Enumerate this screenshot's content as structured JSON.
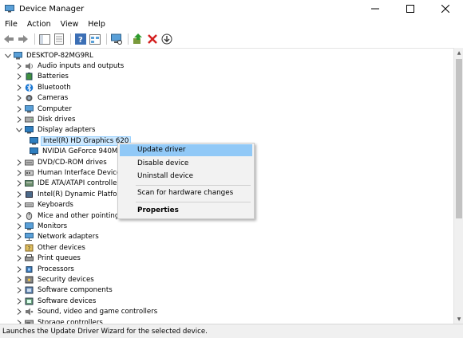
{
  "window": {
    "title": "Device Manager",
    "controls": {
      "minimize": "—",
      "maximize": "☐",
      "close": "✕"
    }
  },
  "menu": [
    "File",
    "Action",
    "View",
    "Help"
  ],
  "toolbar": {
    "buttons": [
      "back-icon",
      "forward-icon",
      "show-hide-icon",
      "properties-icon",
      "help-icon",
      "view-icon",
      "scan-icon",
      "update-driver-icon",
      "uninstall-icon",
      "download-icon"
    ]
  },
  "tree": {
    "root": "DESKTOP-82MG9RL",
    "items": [
      {
        "label": "Audio inputs and outputs",
        "icon": "speaker-icon",
        "expanded": false
      },
      {
        "label": "Batteries",
        "icon": "battery-icon",
        "expanded": false
      },
      {
        "label": "Bluetooth",
        "icon": "bluetooth-icon",
        "expanded": false
      },
      {
        "label": "Cameras",
        "icon": "camera-icon",
        "expanded": false
      },
      {
        "label": "Computer",
        "icon": "computer-icon",
        "expanded": false
      },
      {
        "label": "Disk drives",
        "icon": "disk-icon",
        "expanded": false
      },
      {
        "label": "Display adapters",
        "icon": "display-adapter-icon",
        "expanded": true
      },
      {
        "label": "Intel(R) HD Graphics 620",
        "icon": "display-adapter-icon",
        "child": true,
        "selected": true
      },
      {
        "label": "NVIDIA GeForce 940M",
        "icon": "display-adapter-icon",
        "child": true
      },
      {
        "label": "DVD/CD-ROM drives",
        "icon": "dvd-icon",
        "expanded": false
      },
      {
        "label": "Human Interface Devices",
        "icon": "hid-icon",
        "expanded": false
      },
      {
        "label": "IDE ATA/ATAPI controllers",
        "icon": "ide-icon",
        "expanded": false
      },
      {
        "label": "Intel(R) Dynamic Platform and Thermal Framework",
        "icon": "chip-icon",
        "expanded": false
      },
      {
        "label": "Keyboards",
        "icon": "keyboard-icon",
        "expanded": false
      },
      {
        "label": "Mice and other pointing devices",
        "icon": "mouse-icon",
        "expanded": false
      },
      {
        "label": "Monitors",
        "icon": "monitor-icon",
        "expanded": false
      },
      {
        "label": "Network adapters",
        "icon": "network-icon",
        "expanded": false
      },
      {
        "label": "Other devices",
        "icon": "other-devices-icon",
        "expanded": false
      },
      {
        "label": "Print queues",
        "icon": "printer-icon",
        "expanded": false
      },
      {
        "label": "Processors",
        "icon": "processor-icon",
        "expanded": false
      },
      {
        "label": "Security devices",
        "icon": "security-icon",
        "expanded": false
      },
      {
        "label": "Software components",
        "icon": "software-component-icon",
        "expanded": false
      },
      {
        "label": "Software devices",
        "icon": "software-device-icon",
        "expanded": false
      },
      {
        "label": "Sound, video and game controllers",
        "icon": "sound-icon",
        "expanded": false
      },
      {
        "label": "Storage controllers",
        "icon": "storage-icon",
        "expanded": false
      }
    ]
  },
  "context_menu": {
    "items": [
      "Update driver",
      "Disable device",
      "Uninstall device",
      "Scan for hardware changes",
      "Properties"
    ],
    "highlighted": "Update driver",
    "bold": "Properties"
  },
  "status": "Launches the Update Driver Wizard for the selected device.",
  "colors": {
    "selection": "#cce8ff",
    "menu_highlight": "#91c9f7",
    "accent": "#2f7fc0"
  }
}
